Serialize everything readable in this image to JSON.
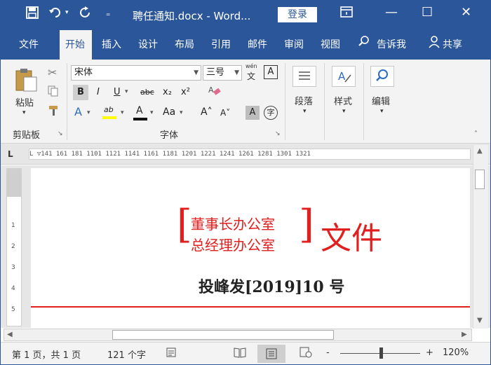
{
  "window": {
    "title": "聘任通知.docx  -  Word...",
    "login_label": "登录",
    "minimize": "—",
    "maximize": "☐",
    "close": "✕"
  },
  "tabs": [
    "文件",
    "开始",
    "插入",
    "设计",
    "布局",
    "引用",
    "邮件",
    "审阅",
    "视图"
  ],
  "active_tab": "开始",
  "tell_me": "告诉我",
  "share": "共享",
  "ribbon": {
    "clipboard": {
      "paste": "粘贴",
      "group": "剪贴板"
    },
    "font": {
      "name": "宋体",
      "size": "三号",
      "group": "字体",
      "phonetic": "wén",
      "phonetic_char": "文",
      "bold": "B",
      "italic": "I",
      "underline": "U",
      "strike": "abc",
      "subscript": "x₂",
      "superscript": "x²",
      "change_case": "Aa",
      "grow": "A˄",
      "shrink": "A˅",
      "text_effect": "A",
      "char_shading": "A",
      "enclose": "字",
      "highlight": "ab",
      "font_color": "A"
    },
    "paragraph": {
      "label": "段落"
    },
    "styles": {
      "label": "样式"
    },
    "editing": {
      "label": "编辑"
    }
  },
  "ruler": {
    "text": "L  ▽141  161  181  1101  1121  1141  1161  1181  1201  1221  1241  1261  1281  1301  1321",
    "vertical": [
      "1",
      "2",
      "3",
      "4",
      "5"
    ]
  },
  "document": {
    "issuer_line1": "董事长办公室",
    "issuer_line2": "总经理办公室",
    "title": "文件",
    "doc_number": "投峰发[2019]10 号",
    "accent_color": "#e0201f"
  },
  "status": {
    "page": "第 1 页，共 1 页",
    "words": "121 个字",
    "zoom": "120%",
    "zoom_minus": "-",
    "zoom_plus": "+"
  }
}
